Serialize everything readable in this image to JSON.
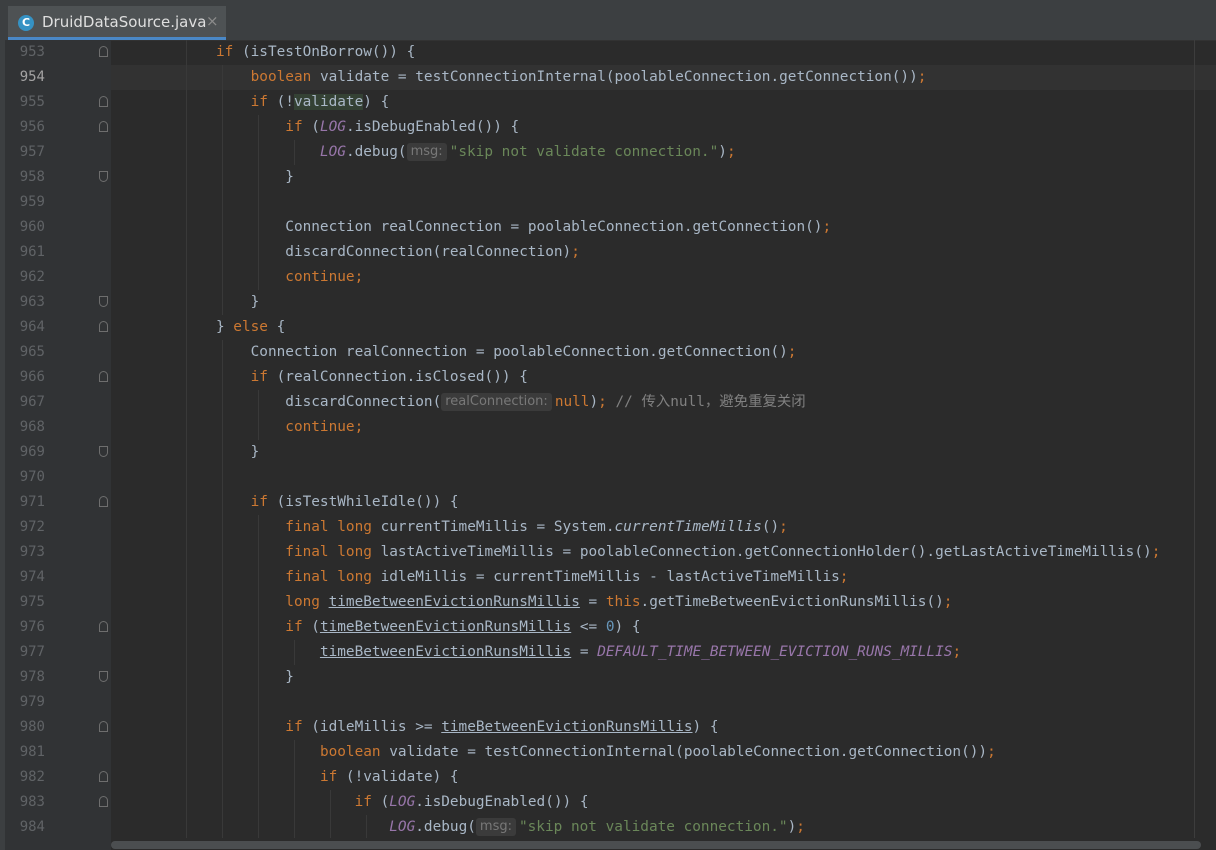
{
  "tab": {
    "filename": "DruidDataSource.java",
    "icon": "C",
    "close": "×"
  },
  "colors": {
    "keyword": "#cc7832",
    "static": "#9876aa",
    "string": "#6a8759",
    "number": "#6897bb",
    "comment": "#808080",
    "default": "#a9b7c6"
  },
  "lines": [
    {
      "n": "953",
      "fold": "open",
      "code": [
        {
          "t": "            "
        },
        {
          "t": "if",
          "c": "kw"
        },
        {
          "t": " (isTestOnBorrow()) {"
        }
      ]
    },
    {
      "n": "954",
      "current": true,
      "code": [
        {
          "t": "                "
        },
        {
          "t": "boolean",
          "c": "kw"
        },
        {
          "t": " validate = testConnectionInternal(poolableConnection.getConnection())"
        },
        {
          "t": ";",
          "c": "kw"
        }
      ]
    },
    {
      "n": "955",
      "fold": "open",
      "code": [
        {
          "t": "                "
        },
        {
          "t": "if",
          "c": "kw"
        },
        {
          "t": " (!"
        },
        {
          "t": "validate",
          "c": "hl"
        },
        {
          "t": ") {"
        }
      ]
    },
    {
      "n": "956",
      "fold": "open",
      "code": [
        {
          "t": "                    "
        },
        {
          "t": "if",
          "c": "kw"
        },
        {
          "t": " ("
        },
        {
          "t": "LOG",
          "c": "st"
        },
        {
          "t": ".isDebugEnabled()) {"
        }
      ]
    },
    {
      "n": "957",
      "code": [
        {
          "t": "                        "
        },
        {
          "t": "LOG",
          "c": "st"
        },
        {
          "t": ".debug("
        },
        {
          "t": "msg:",
          "c": "hint"
        },
        {
          "t": "\"skip not validate connection.\"",
          "c": "str"
        },
        {
          "t": ")"
        },
        {
          "t": ";",
          "c": "kw"
        }
      ]
    },
    {
      "n": "958",
      "fold": "close",
      "code": [
        {
          "t": "                    }"
        }
      ]
    },
    {
      "n": "959",
      "code": []
    },
    {
      "n": "960",
      "code": [
        {
          "t": "                    Connection realConnection = poolableConnection.getConnection()"
        },
        {
          "t": ";",
          "c": "kw"
        }
      ]
    },
    {
      "n": "961",
      "code": [
        {
          "t": "                    discardConnection(realConnection)"
        },
        {
          "t": ";",
          "c": "kw"
        }
      ]
    },
    {
      "n": "962",
      "code": [
        {
          "t": "                    "
        },
        {
          "t": "continue;",
          "c": "kw"
        }
      ]
    },
    {
      "n": "963",
      "fold": "close",
      "code": [
        {
          "t": "                }"
        }
      ]
    },
    {
      "n": "964",
      "fold": "open",
      "code": [
        {
          "t": "            } "
        },
        {
          "t": "else",
          "c": "kw"
        },
        {
          "t": " {"
        }
      ]
    },
    {
      "n": "965",
      "code": [
        {
          "t": "                Connection realConnection = poolableConnection.getConnection()"
        },
        {
          "t": ";",
          "c": "kw"
        }
      ]
    },
    {
      "n": "966",
      "fold": "open",
      "code": [
        {
          "t": "                "
        },
        {
          "t": "if",
          "c": "kw"
        },
        {
          "t": " (realConnection.isClosed()) {"
        }
      ]
    },
    {
      "n": "967",
      "code": [
        {
          "t": "                    discardConnection("
        },
        {
          "t": "realConnection:",
          "c": "hint"
        },
        {
          "t": "null",
          "c": "kw"
        },
        {
          "t": ")"
        },
        {
          "t": ";",
          "c": "kw"
        },
        {
          "t": " // 传入null，避免重复关闭",
          "c": "cm"
        }
      ]
    },
    {
      "n": "968",
      "code": [
        {
          "t": "                    "
        },
        {
          "t": "continue;",
          "c": "kw"
        }
      ]
    },
    {
      "n": "969",
      "fold": "close",
      "code": [
        {
          "t": "                }"
        }
      ]
    },
    {
      "n": "970",
      "code": []
    },
    {
      "n": "971",
      "fold": "open",
      "code": [
        {
          "t": "                "
        },
        {
          "t": "if",
          "c": "kw"
        },
        {
          "t": " (isTestWhileIdle()) {"
        }
      ]
    },
    {
      "n": "972",
      "code": [
        {
          "t": "                    "
        },
        {
          "t": "final long",
          "c": "kw"
        },
        {
          "t": " currentTimeMillis = System."
        },
        {
          "t": "currentTimeMillis",
          "c": "it"
        },
        {
          "t": "()"
        },
        {
          "t": ";",
          "c": "kw"
        }
      ]
    },
    {
      "n": "973",
      "code": [
        {
          "t": "                    "
        },
        {
          "t": "final long",
          "c": "kw"
        },
        {
          "t": " lastActiveTimeMillis = poolableConnection.getConnectionHolder().getLastActiveTimeMillis()"
        },
        {
          "t": ";",
          "c": "kw"
        }
      ]
    },
    {
      "n": "974",
      "code": [
        {
          "t": "                    "
        },
        {
          "t": "final long",
          "c": "kw"
        },
        {
          "t": " idleMillis = currentTimeMillis - lastActiveTimeMillis"
        },
        {
          "t": ";",
          "c": "kw"
        }
      ]
    },
    {
      "n": "975",
      "code": [
        {
          "t": "                    "
        },
        {
          "t": "long",
          "c": "kw"
        },
        {
          "t": " "
        },
        {
          "t": "timeBetweenEvictionRunsMillis",
          "c": "ul"
        },
        {
          "t": " = "
        },
        {
          "t": "this",
          "c": "kw"
        },
        {
          "t": ".getTimeBetweenEvictionRunsMillis()"
        },
        {
          "t": ";",
          "c": "kw"
        }
      ]
    },
    {
      "n": "976",
      "fold": "open",
      "code": [
        {
          "t": "                    "
        },
        {
          "t": "if",
          "c": "kw"
        },
        {
          "t": " ("
        },
        {
          "t": "timeBetweenEvictionRunsMillis",
          "c": "ul"
        },
        {
          "t": " <= "
        },
        {
          "t": "0",
          "c": "num"
        },
        {
          "t": ") {"
        }
      ]
    },
    {
      "n": "977",
      "code": [
        {
          "t": "                        "
        },
        {
          "t": "timeBetweenEvictionRunsMillis",
          "c": "ul"
        },
        {
          "t": " = "
        },
        {
          "t": "DEFAULT_TIME_BETWEEN_EVICTION_RUNS_MILLIS",
          "c": "st"
        },
        {
          "t": ";",
          "c": "kw"
        }
      ]
    },
    {
      "n": "978",
      "fold": "close",
      "code": [
        {
          "t": "                    }"
        }
      ]
    },
    {
      "n": "979",
      "code": []
    },
    {
      "n": "980",
      "fold": "open",
      "code": [
        {
          "t": "                    "
        },
        {
          "t": "if",
          "c": "kw"
        },
        {
          "t": " (idleMillis >= "
        },
        {
          "t": "timeBetweenEvictionRunsMillis",
          "c": "ul"
        },
        {
          "t": ") {"
        }
      ]
    },
    {
      "n": "981",
      "code": [
        {
          "t": "                        "
        },
        {
          "t": "boolean",
          "c": "kw"
        },
        {
          "t": " validate = testConnectionInternal(poolableConnection.getConnection())"
        },
        {
          "t": ";",
          "c": "kw"
        }
      ]
    },
    {
      "n": "982",
      "fold": "open",
      "code": [
        {
          "t": "                        "
        },
        {
          "t": "if",
          "c": "kw"
        },
        {
          "t": " (!validate) {"
        }
      ]
    },
    {
      "n": "983",
      "fold": "open",
      "code": [
        {
          "t": "                            "
        },
        {
          "t": "if",
          "c": "kw"
        },
        {
          "t": " ("
        },
        {
          "t": "LOG",
          "c": "st"
        },
        {
          "t": ".isDebugEnabled()) {"
        }
      ]
    },
    {
      "n": "984",
      "code": [
        {
          "t": "                                "
        },
        {
          "t": "LOG",
          "c": "st"
        },
        {
          "t": ".debug("
        },
        {
          "t": "msg:",
          "c": "hint"
        },
        {
          "t": "\"skip not validate connection.\"",
          "c": "str"
        },
        {
          "t": ")"
        },
        {
          "t": ";",
          "c": "kw"
        }
      ]
    }
  ]
}
